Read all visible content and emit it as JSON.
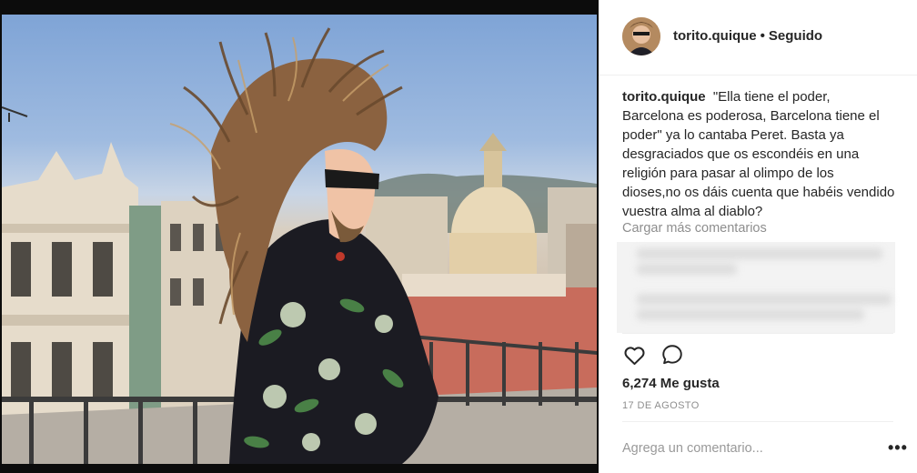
{
  "post": {
    "username": "torito.quique",
    "follow_status": "Seguido",
    "separator": "•",
    "caption_user": "torito.quique",
    "caption_text": "\"Ella tiene el poder, Barcelona es poderosa, Barcelona tiene el poder\" ya lo cantaba Peret. Basta ya desgraciados que os escondéis en una religión para pasar al olimpo de los dioses,no os dáis cuenta que habéis vendido vuestra alma al diablo?",
    "load_more": "Cargar más comentarios",
    "likes": "6,274 Me gusta",
    "date": "17 DE AGOSTO",
    "comment_placeholder": "Agrega un comentario...",
    "more_options": "•••"
  },
  "colors": {
    "text": "#262626",
    "muted": "#8e8e8e",
    "divider": "#efefef"
  },
  "icons": {
    "like": "heart-outline-icon",
    "comment": "speech-bubble-outline-icon",
    "more": "more-dots-icon"
  }
}
